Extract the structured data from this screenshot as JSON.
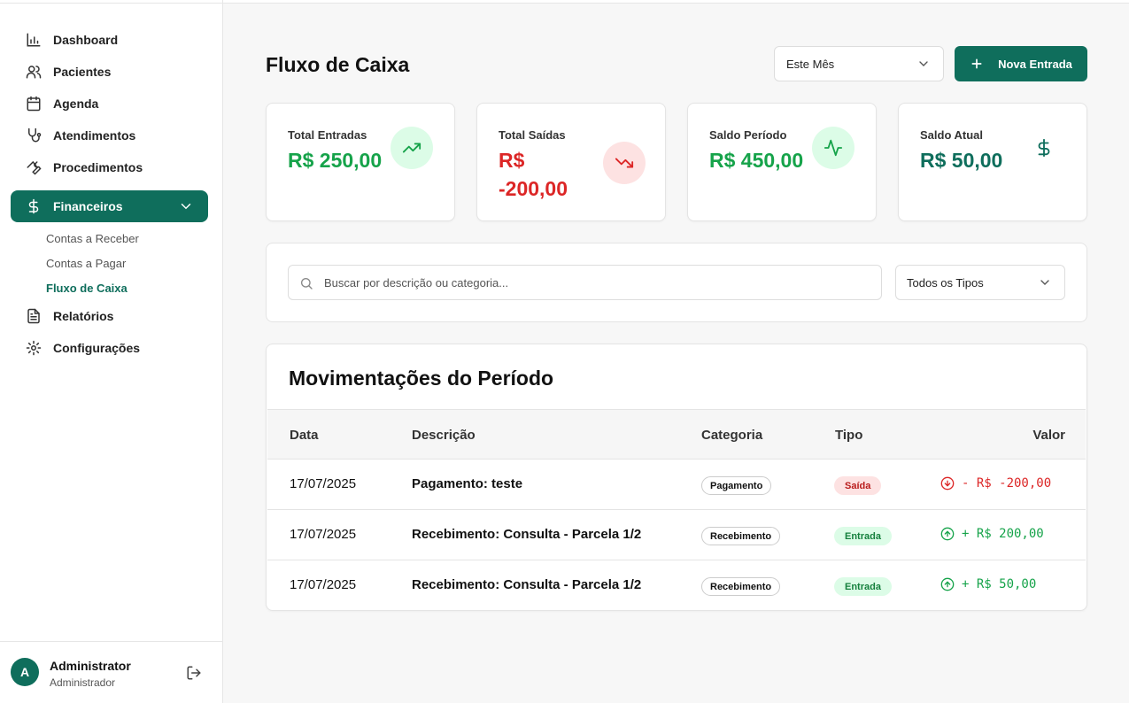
{
  "sidebar": {
    "items": [
      {
        "label": "Dashboard",
        "icon": "bar-chart-icon"
      },
      {
        "label": "Pacientes",
        "icon": "users-icon"
      },
      {
        "label": "Agenda",
        "icon": "calendar-icon"
      },
      {
        "label": "Atendimentos",
        "icon": "stethoscope-icon"
      },
      {
        "label": "Procedimentos",
        "icon": "wrench-icon"
      },
      {
        "label": "Financeiros",
        "icon": "dollar-icon"
      },
      {
        "label": "Relatórios",
        "icon": "file-text-icon"
      },
      {
        "label": "Configurações",
        "icon": "gear-icon"
      }
    ],
    "sub_items": [
      "Contas a Receber",
      "Contas a Pagar",
      "Fluxo de Caixa"
    ]
  },
  "user": {
    "initial": "A",
    "name": "Administrator",
    "role": "Administrador"
  },
  "header": {
    "title": "Fluxo de Caixa",
    "period_select": "Este Mês",
    "new_button": "Nova Entrada"
  },
  "cards": [
    {
      "label": "Total Entradas",
      "value": "R$ 250,00",
      "icon": "trending-up-icon"
    },
    {
      "label": "Total Saídas",
      "value_line1": "R$",
      "value_line2": "-200,00",
      "icon": "trending-down-icon"
    },
    {
      "label": "Saldo Período",
      "value": "R$ 450,00",
      "icon": "activity-icon"
    },
    {
      "label": "Saldo Atual",
      "value": "R$ 50,00",
      "icon": "dollar-icon"
    }
  ],
  "filters": {
    "search_placeholder": "Buscar por descrição ou categoria...",
    "type_select": "Todos os Tipos"
  },
  "table": {
    "title": "Movimentações do Período",
    "columns": [
      "Data",
      "Descrição",
      "Categoria",
      "Tipo",
      "Valor"
    ],
    "rows": [
      {
        "date": "17/07/2025",
        "description": "Pagamento: teste",
        "category": "Pagamento",
        "type": "Saída",
        "amount": "- R$ -200,00"
      },
      {
        "date": "17/07/2025",
        "description": "Recebimento: Consulta - Parcela 1/2",
        "category": "Recebimento",
        "type": "Entrada",
        "amount": "+ R$ 200,00"
      },
      {
        "date": "17/07/2025",
        "description": "Recebimento: Consulta - Parcela 1/2",
        "category": "Recebimento",
        "type": "Entrada",
        "amount": "+ R$ 50,00"
      }
    ]
  },
  "colors": {
    "brand": "#0f6e5c",
    "positive": "#16a34a",
    "negative": "#dc2626"
  }
}
